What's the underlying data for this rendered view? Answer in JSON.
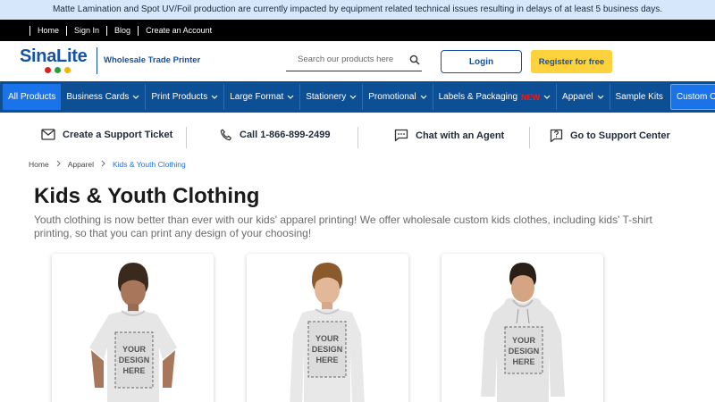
{
  "announcement": "Matte Lamination and Spot UV/Foil production are currently impacted by equipment related technical issues resulting in delays of at least 5 business days.",
  "top_links": [
    "Home",
    "Sign In",
    "Blog",
    "Create an Account"
  ],
  "header": {
    "logo_text": "SinaLite",
    "logo_dot_colors": [
      "#e02020",
      "#22a13f",
      "#f5b400"
    ],
    "tagline": "Wholesale Trade Printer",
    "search_placeholder": "Search our products here",
    "login_label": "Login",
    "register_label": "Register for free"
  },
  "nav": {
    "items": [
      "All Products",
      "Business Cards",
      "Print Products",
      "Large Format",
      "Stationery",
      "Promotional",
      "Labels & Packaging",
      "Apparel",
      "Sample Kits",
      "Custom Order"
    ],
    "new_badge": "NEW"
  },
  "support": {
    "ticket": "Create a Support Ticket",
    "call": "Call 1-866-899-2499",
    "chat": "Chat with an Agent",
    "center": "Go to Support Center"
  },
  "breadcrumb": [
    "Home",
    "Apparel",
    "Kids & Youth Clothing"
  ],
  "page": {
    "title": "Kids & Youth Clothing",
    "description": "Youth clothing is now better than ever with our kids' apparel printing! We offer wholesale custom kids clothes, including kids' T-shirt printing, so that you can print any design of your choosing!"
  },
  "products": [
    {
      "type": "t-shirt",
      "print_text": [
        "YOUR",
        "DESIGN",
        "HERE"
      ]
    },
    {
      "type": "long-sleeve",
      "print_text": [
        "YOUR",
        "DESIGN",
        "HERE"
      ]
    },
    {
      "type": "hoodie",
      "print_text": [
        "YOUR",
        "DESIGN",
        "HERE"
      ]
    }
  ],
  "colors": {
    "brand_blue": "#1552a3",
    "nav_bg": "#0d4f95",
    "nav_active": "#1a73e8",
    "register_yellow": "#fdd23d",
    "announce_bg": "#d6e6fb"
  }
}
